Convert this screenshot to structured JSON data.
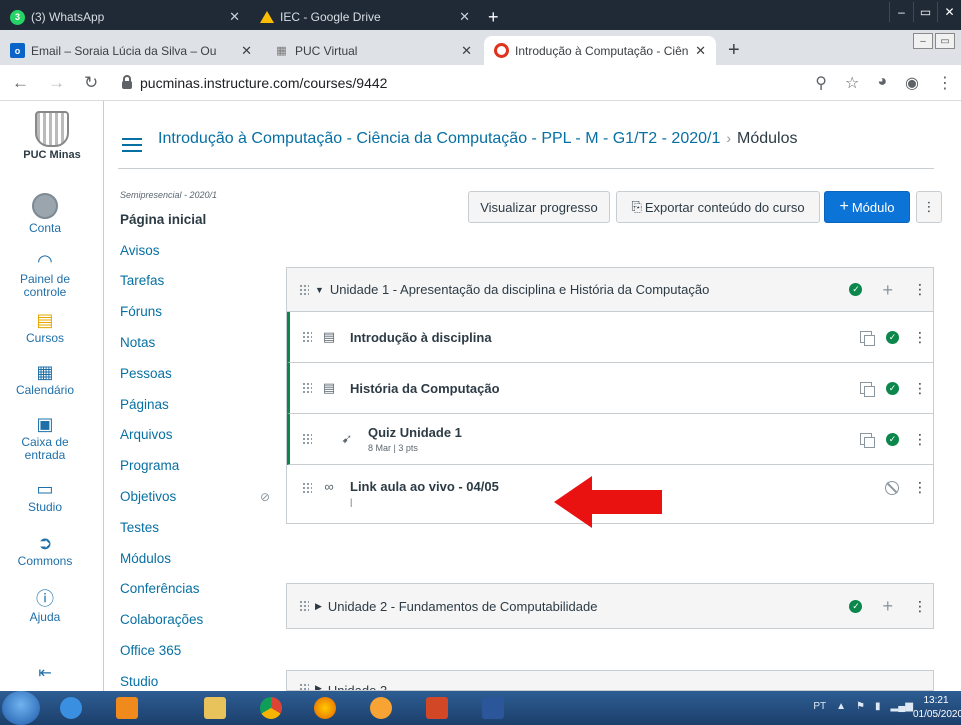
{
  "browser": {
    "outer_tabs": [
      {
        "badge": "3",
        "label": "(3) WhatsApp"
      },
      {
        "label": "IEC - Google Drive"
      }
    ],
    "inner_tabs": [
      {
        "label": "Email – Soraia Lúcia da Silva – Ou"
      },
      {
        "label": "PUC Virtual"
      },
      {
        "label": "Introdução à Computação - Ciên"
      }
    ],
    "url": "pucminas.instructure.com/courses/9442"
  },
  "global_nav": {
    "logo_label": "PUC Minas",
    "items": [
      {
        "label": "Conta",
        "icon": "user-avatar-icon"
      },
      {
        "label": "Painel de controle",
        "icon": "dashboard-icon"
      },
      {
        "label": "Cursos",
        "icon": "book-icon"
      },
      {
        "label": "Calendário",
        "icon": "calendar-icon"
      },
      {
        "label": "Caixa de entrada",
        "icon": "inbox-icon"
      },
      {
        "label": "Studio",
        "icon": "studio-icon"
      },
      {
        "label": "Commons",
        "icon": "commons-icon"
      },
      {
        "label": "Ajuda",
        "icon": "help-icon"
      }
    ]
  },
  "breadcrumb": {
    "course": "Introdução à Computação - Ciência da Computação - PPL - M - G1/T2 - 2020/1",
    "separator": "›",
    "current": "Módulos"
  },
  "course_nav": {
    "term": "Semipresencial - 2020/1",
    "items": [
      "Página inicial",
      "Avisos",
      "Tarefas",
      "Fóruns",
      "Notas",
      "Pessoas",
      "Páginas",
      "Arquivos",
      "Programa",
      "Objetivos",
      "Testes",
      "Módulos",
      "Conferências",
      "Colaborações",
      "Office 365",
      "Studio"
    ]
  },
  "toolbar": {
    "progress": "Visualizar progresso",
    "export": "Exportar conteúdo do curso",
    "add_module": "Módulo"
  },
  "modules": [
    {
      "title": "Unidade 1 - Apresentação da disciplina e História da Computação",
      "items": [
        {
          "title": "Introdução à disciplina",
          "type": "page-icon",
          "published": true
        },
        {
          "title": "História da Computação",
          "type": "page-icon",
          "published": true
        },
        {
          "title": "Quiz Unidade 1",
          "meta": "8 Mar | 3 pts",
          "type": "quiz-icon",
          "published": true
        },
        {
          "title": "Link aula ao vivo - 04/05",
          "type": "link-icon",
          "published": false
        }
      ]
    },
    {
      "title": "Unidade 2 - Fundamentos de Computabilidade"
    },
    {
      "title": "Unidade 3"
    }
  ],
  "taskbar": {
    "lang": "PT",
    "time": "13:21",
    "date": "01/05/2020"
  },
  "colors": {
    "link": "#0770a3",
    "published": "#0b874b",
    "primary": "#0b74d6",
    "arrow": "#ea1111"
  }
}
